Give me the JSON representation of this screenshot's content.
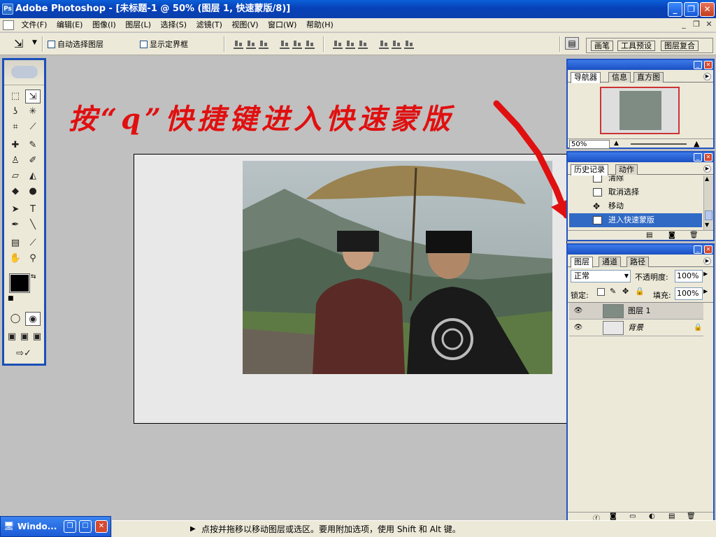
{
  "window": {
    "title": "Adobe Photoshop - [未标题-1 @ 50% (图层 1, 快速蒙版/8)]",
    "min_glyph": "_",
    "max_glyph": "❐",
    "close_glyph": "✕"
  },
  "menu": {
    "items": [
      "文件(F)",
      "编辑(E)",
      "图像(I)",
      "图层(L)",
      "选择(S)",
      "滤镜(T)",
      "视图(V)",
      "窗口(W)",
      "帮助(H)"
    ],
    "doc_min": "_",
    "doc_restore": "❐",
    "doc_close": "✕"
  },
  "options": {
    "auto_select_label": "自动选择图层",
    "show_bounds_label": "显示定界框",
    "well_tabs": [
      "画笔",
      "工具预设",
      "图层复合"
    ]
  },
  "annotation": {
    "text": "按“q”快捷键进入快速蒙版",
    "color": "#e01010"
  },
  "navigator": {
    "tabs": [
      "导航器",
      "信息",
      "直方图"
    ],
    "zoom": "50%"
  },
  "history": {
    "tabs": [
      "历史记录",
      "动作"
    ],
    "items": [
      {
        "label": "清除",
        "icon": "document-icon"
      },
      {
        "label": "取消选择",
        "icon": "document-icon"
      },
      {
        "label": "移动",
        "icon": "move-icon"
      },
      {
        "label": "进入快速蒙版",
        "icon": "document-icon",
        "selected": true
      }
    ]
  },
  "layers": {
    "tabs": [
      "图层",
      "通道",
      "路径"
    ],
    "blend_mode": "正常",
    "opacity_label": "不透明度:",
    "opacity_value": "100%",
    "lock_label": "锁定:",
    "fill_label": "填充:",
    "fill_value": "100%",
    "rows": [
      {
        "name": "图层 1",
        "visible": true
      },
      {
        "name": "背景",
        "visible": true,
        "locked": true
      }
    ]
  },
  "taskbar": {
    "label": "Windo..."
  },
  "status": {
    "text": "点按并拖移以移动图层或选区。要用附加选项，使用 Shift 和 Alt 键。"
  },
  "colors": {
    "accent": "#0a5fd8",
    "selection": "#316ac5",
    "arrow": "#e01010"
  }
}
